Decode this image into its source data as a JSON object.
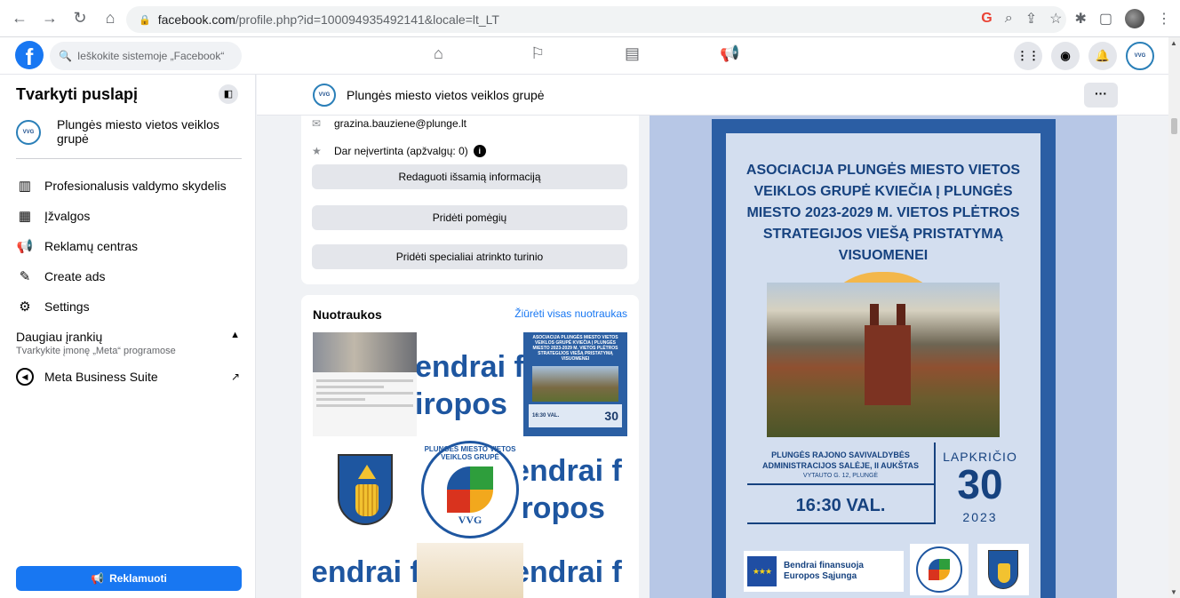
{
  "browser": {
    "url_host": "facebook.com",
    "url_path": "/profile.php?id=100094935492141&locale=lt_LT",
    "nav_icons": [
      "back-icon",
      "forward-icon",
      "reload-icon",
      "home-icon"
    ],
    "right_icons": [
      "google-icon",
      "zoom-icon",
      "share-icon",
      "bookmark-star-icon",
      "extensions-icon",
      "sidepanel-icon",
      "profile-avatar-icon",
      "menu-kebab-icon"
    ]
  },
  "fb": {
    "logo": "f",
    "search_placeholder": "Ieškokite sistemoje „Facebook“",
    "nav_icons": [
      "home-icon",
      "flag-icon",
      "dashboard-icon",
      "megaphone-icon"
    ],
    "right_icons": [
      "apps-grid-icon",
      "messenger-icon",
      "notifications-bell-icon",
      "page-avatar-icon"
    ]
  },
  "sidebar": {
    "title": "Tvarkyti puslapį",
    "page_name": "Plungės miesto vietos veiklos grupė",
    "items": [
      {
        "label": "Profesionalusis valdymo skydelis",
        "icon": "dashboard-icon"
      },
      {
        "label": "Įžvalgos",
        "icon": "insights-icon"
      },
      {
        "label": "Reklamų centras",
        "icon": "megaphone-icon"
      },
      {
        "label": "Create ads",
        "icon": "pencil-icon"
      },
      {
        "label": "Settings",
        "icon": "gear-icon"
      }
    ],
    "more_title": "Daugiau įrankių",
    "more_subtitle": "Tvarkykite įmonę „Meta“ programose",
    "meta_business": "Meta Business Suite",
    "promote": "Reklamuoti"
  },
  "page_header": {
    "name": "Plungės miesto vietos veiklos grupė",
    "more": "···"
  },
  "info": {
    "email": "grazina.bauziene@plunge.lt",
    "rating": "Dar neįvertinta (apžvalgų: 0)",
    "btn_edit": "Redaguoti išsamią informaciją",
    "btn_hobbies": "Pridėti pomėgių",
    "btn_featured": "Pridėti specialiai atrinkto turinio"
  },
  "photos": {
    "title": "Nuotraukos",
    "see_all": "Žiūrėti visas nuotraukas",
    "fragment_a": "endrai f",
    "fragment_b": "iropos",
    "poster_thumb_date": "30",
    "poster_thumb_time": "16:30 VAL.",
    "vvg_label": "VVG",
    "vvg_ring": "PLUNGĖS MIESTO VIETOS VEIKLOS GRUPĖ"
  },
  "poster": {
    "title": "ASOCIACIJA PLUNGĖS MIESTO VIETOS VEIKLOS GRUPĖ KVIEČIA Į PLUNGĖS MIESTO 2023-2029 M. VIETOS PLĖTROS STRATEGIJOS VIEŠĄ PRISTATYMĄ VISUOMENEI",
    "venue": "PLUNGĖS RAJONO SAVIVALDYBĖS ADMINISTRACIJOS SALĖJE, II AUKŠTAS",
    "address": "VYTAUTO G. 12, PLUNGĖ",
    "time": "16:30 VAL.",
    "month": "LAPKRIČIO",
    "day": "30",
    "year": "2023",
    "eu_text": "Bendrai finansuoja Europos Sąjunga"
  }
}
